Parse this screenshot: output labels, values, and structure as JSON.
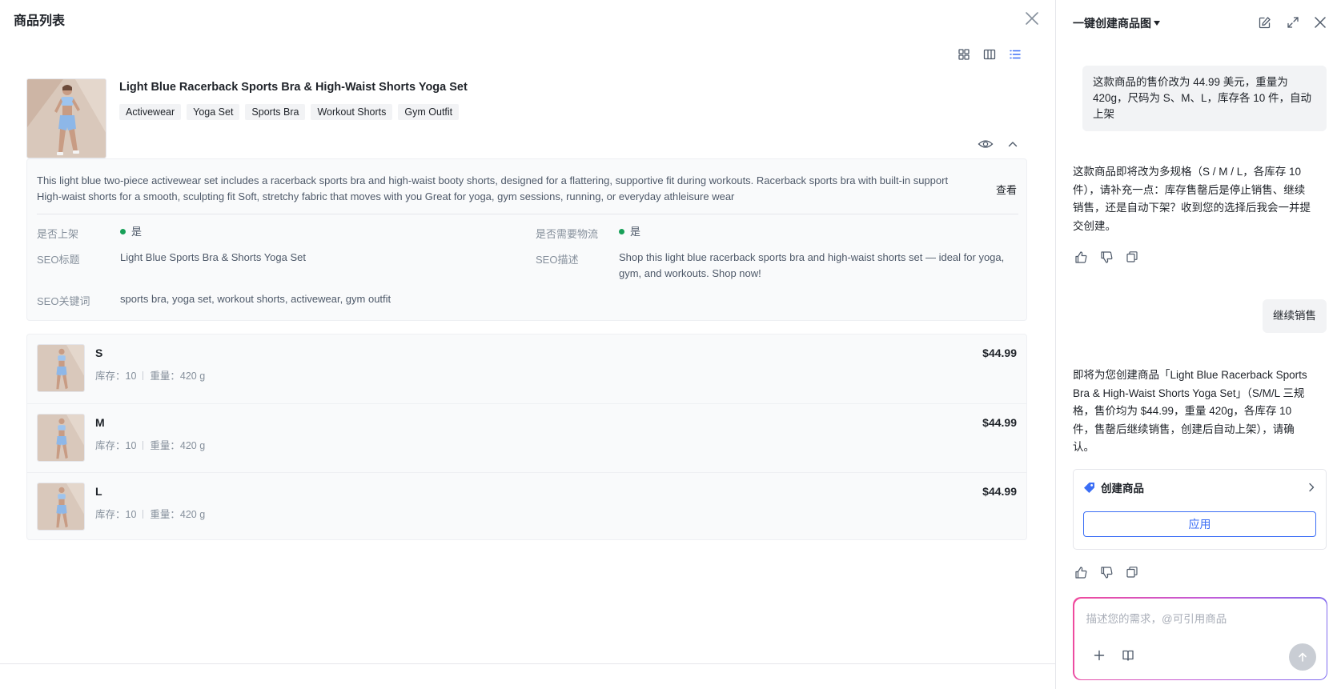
{
  "left_panel": {
    "title": "商品列表",
    "view_toggles": [
      {
        "name": "grid-view",
        "active": false
      },
      {
        "name": "column-view",
        "active": false
      },
      {
        "name": "list-view",
        "active": true
      }
    ],
    "product": {
      "name": "Light Blue Racerback Sports Bra & High-Waist Shorts Yoga Set",
      "tags": [
        "Activewear",
        "Yoga Set",
        "Sports Bra",
        "Workout Shorts",
        "Gym Outfit"
      ],
      "description": "This light blue two-piece activewear set includes a racerback sports bra and high-waist booty shorts, designed for a flattering, supportive fit during workouts. Racerback sports bra with built-in support High-waist shorts for a smooth, sculpting fit Soft, stretchy fabric that moves with you Great for yoga, gym sessions, running, or everyday athleisure wear",
      "view_label": "查看",
      "fields": {
        "listed_label": "是否上架",
        "listed_value": "是",
        "logistics_label": "是否需要物流",
        "logistics_value": "是",
        "seo_title_label": "SEO标题",
        "seo_title_value": "Light Blue Sports Bra & Shorts Yoga Set",
        "seo_desc_label": "SEO描述",
        "seo_desc_value": "Shop this light blue racerback sports bra and high-waist shorts set — ideal for yoga, gym, and workouts. Shop now!",
        "seo_keywords_label": "SEO关键词",
        "seo_keywords_value": "sports bra, yoga set, workout shorts, activewear, gym outfit"
      },
      "status_color": "#18a058",
      "variants": [
        {
          "size": "S",
          "stock_label": "库存：10",
          "weight_label": "重量：420 g",
          "price": "$44.99"
        },
        {
          "size": "M",
          "stock_label": "库存：10",
          "weight_label": "重量：420 g",
          "price": "$44.99"
        },
        {
          "size": "L",
          "stock_label": "库存：10",
          "weight_label": "重量：420 g",
          "price": "$44.99"
        }
      ]
    }
  },
  "right_panel": {
    "title": "一键创建商品图",
    "header_icons": [
      "edit-icon",
      "expand-icon",
      "close-icon"
    ],
    "messages": {
      "user_1": "这款商品的售价改为 44.99 美元，重量为 420g，尺码为 S、M、L，库存各 10 件，自动上架",
      "ai_1": "这款商品即将改为多规格（S / M / L，各库存 10 件），请补充一点：库存售罄后是停止销售、继续销售，还是自动下架？收到您的选择后我会一并提交创建。",
      "user_2": "继续销售",
      "ai_2": "即将为您创建商品「Light Blue Racerback Sports Bra & High-Waist Shorts Yoga Set」（S/M/L 三规格，售价均为 $44.99，重量 420g，各库存 10 件，售罄后继续销售，创建后自动上架），请确认。"
    },
    "tool_card": {
      "title": "创建商品",
      "apply_label": "应用"
    },
    "composer": {
      "placeholder": "描述您的需求，@可引用商品"
    },
    "accent_color": "#3b6ef5"
  }
}
